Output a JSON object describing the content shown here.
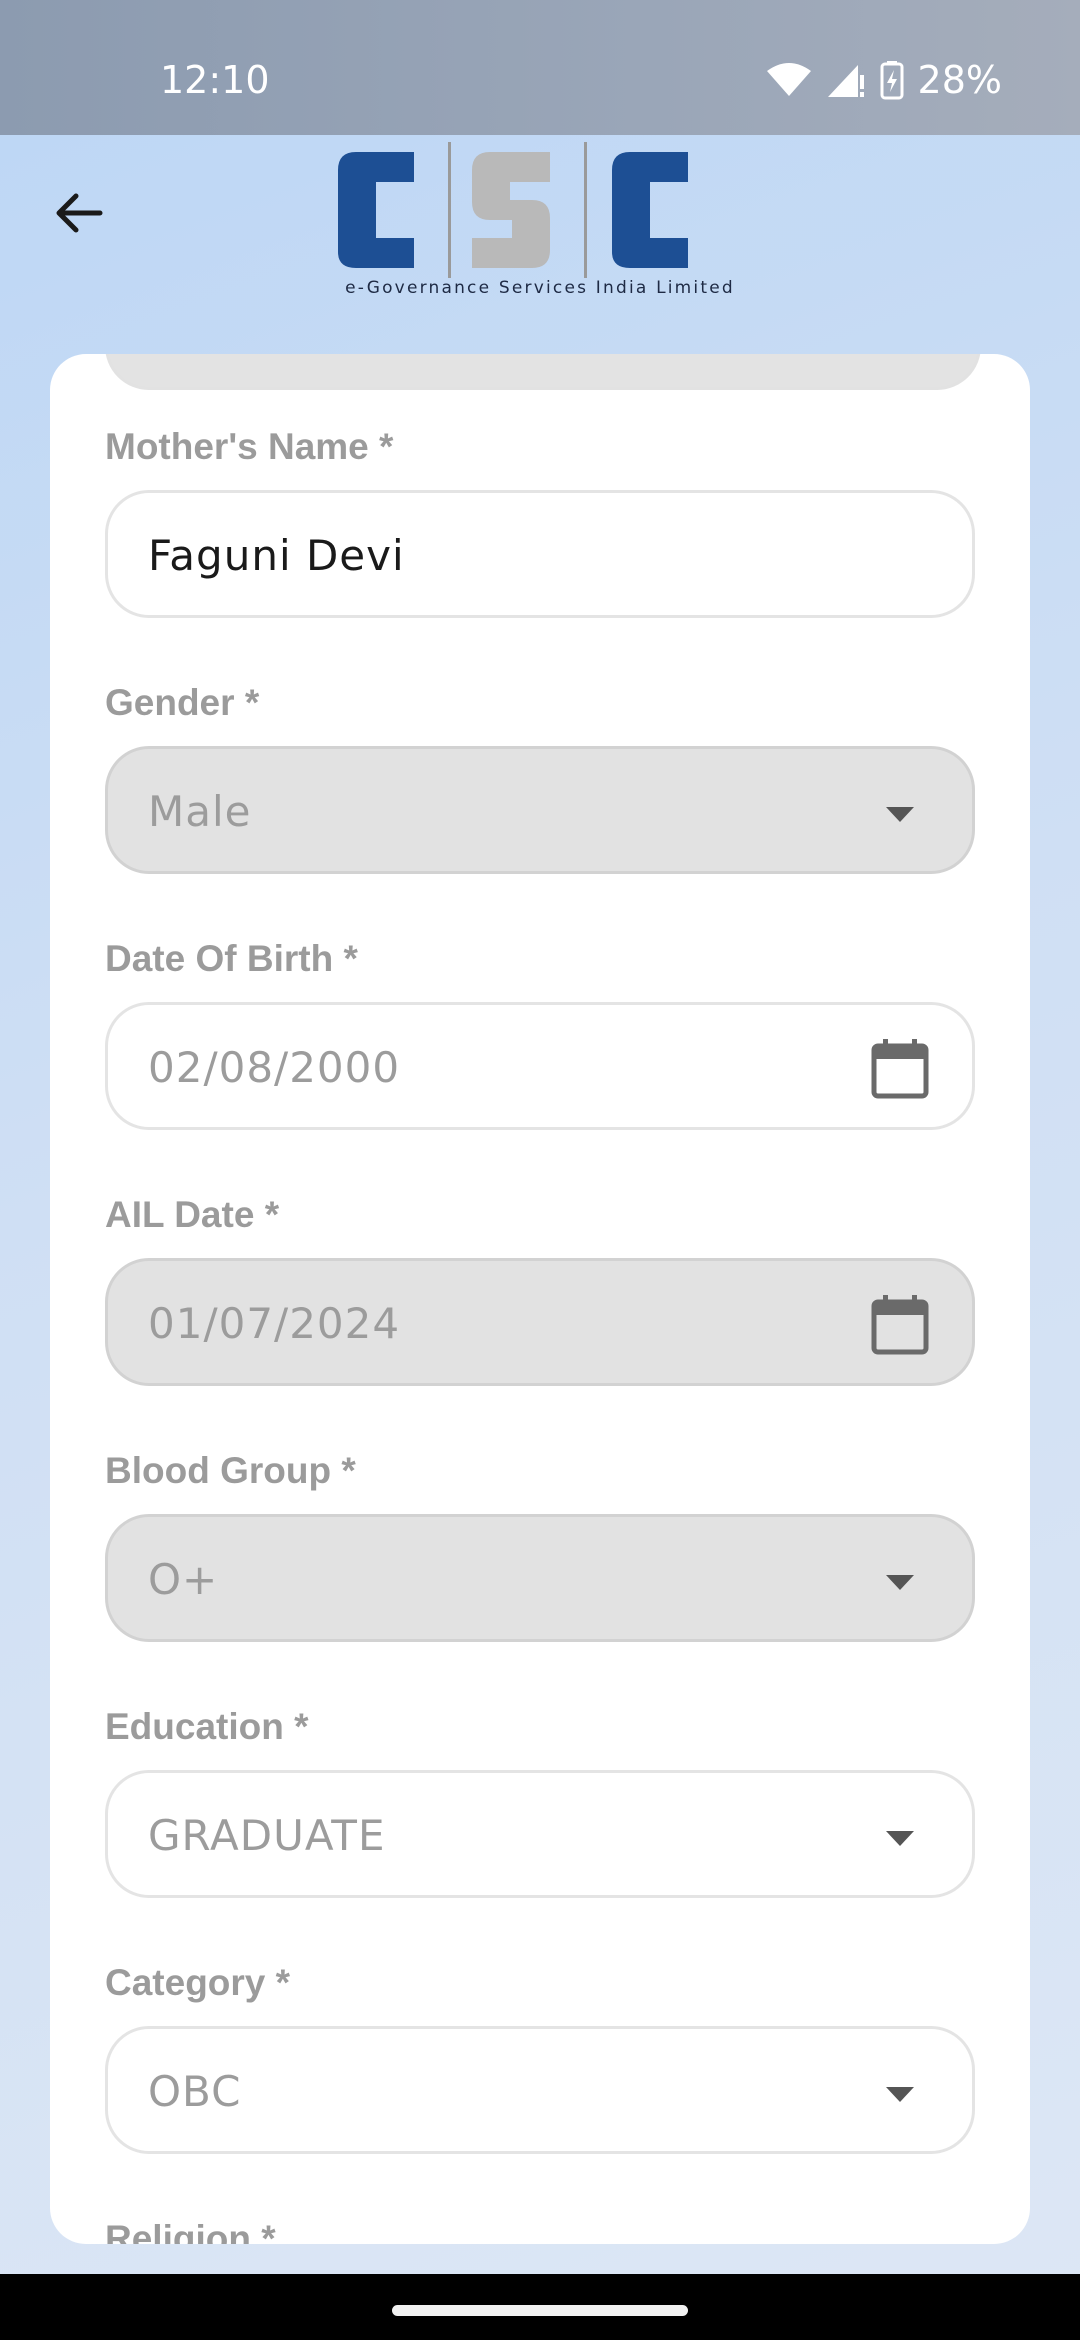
{
  "status_bar": {
    "time": "12:10",
    "battery": "28%"
  },
  "header": {
    "logo_text": "CSC",
    "tagline": "e-Governance Services India Limited"
  },
  "form": {
    "mothers_name": {
      "label": "Mother's Name *",
      "value": "Faguni Devi"
    },
    "gender": {
      "label": "Gender *",
      "value": "Male"
    },
    "dob": {
      "label": "Date Of Birth *",
      "value": "02/08/2000"
    },
    "ail_date": {
      "label": "AIL Date *",
      "value": "01/07/2024"
    },
    "blood_group": {
      "label": "Blood Group *",
      "value": "O+"
    },
    "education": {
      "label": "Education *",
      "value": "GRADUATE"
    },
    "category": {
      "label": "Category *",
      "value": "OBC"
    },
    "religion": {
      "label": "Religion *"
    }
  },
  "colors": {
    "logo_blue": "#1d4f94",
    "logo_grey": "#b9b9b9",
    "label_grey": "#9b9b9b",
    "disabled_fill": "#e2e2e2"
  }
}
